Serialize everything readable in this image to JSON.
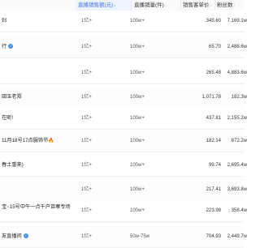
{
  "header": {
    "col1": "直播销售额(元)",
    "col2": "直播销量(件)",
    "col3": "销售客单价",
    "col4": "粉丝数"
  },
  "rows": [
    {
      "name": "妇",
      "verified": false,
      "col1": "1亿+",
      "col2": "100w+",
      "col3": "345.60",
      "col4": "7,169.1w"
    },
    {
      "name": "行",
      "verified": true,
      "col1": "1亿+",
      "col2": "100w+",
      "col3": "65.70",
      "col4": "2,488.6w"
    },
    {
      "name": "",
      "verified": false,
      "col1": "1亿+",
      "col2": "100w+",
      "col3": "265.48",
      "col4": "4,883.6w"
    },
    {
      "name": "田玉老郑",
      "verified": false,
      "col1": "1亿+",
      "col2": "100w+",
      "col3": "1,071.78",
      "col4": "182.3w"
    },
    {
      "name": "在呢!",
      "verified": false,
      "col1": "1亿+",
      "col2": "100w+",
      "col3": "437.81",
      "col4": "2,155.2w"
    },
    {
      "name": "11月18号17点服饰节",
      "verified": false,
      "flame": true,
      "col1": "1亿+",
      "col2": "100w+",
      "col3": "182.14",
      "col4": "872.2w"
    },
    {
      "name": "春土重来)",
      "verified": false,
      "col1": "1亿+",
      "col2": "100w+",
      "col3": "99.74",
      "col4": "2,695.4w"
    },
    {
      "name": "",
      "verified": false,
      "col1": "1亿+",
      "col2": "100w+",
      "col3": "217.41",
      "col4": "3,693.8w"
    },
    {
      "name": "宝~15号中午一点千户苗寨专场",
      "verified": false,
      "twoLine": true,
      "col1": "1亿+",
      "col2": "100w+",
      "col3": "223.98",
      "col4": "358.4w"
    },
    {
      "name": "友直播间",
      "verified": true,
      "col1": "1亿+",
      "col2": "50w-75w",
      "col3": "704.93",
      "col4": "2,449.7w"
    }
  ]
}
